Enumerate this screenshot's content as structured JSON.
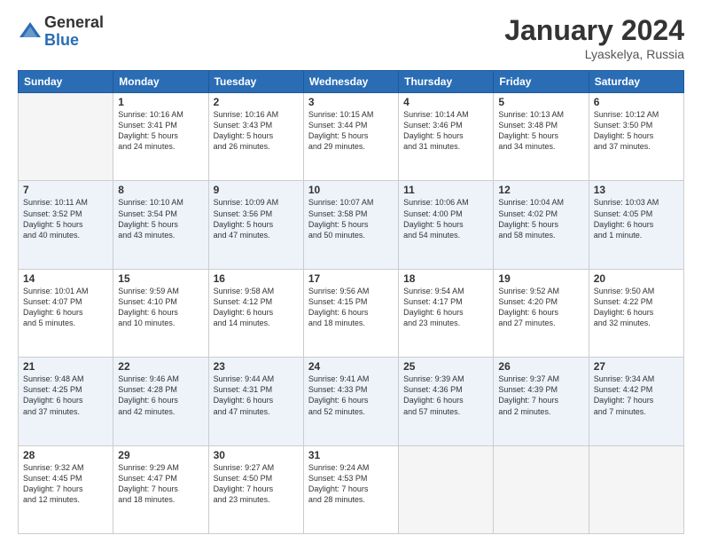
{
  "logo": {
    "general": "General",
    "blue": "Blue"
  },
  "header": {
    "month": "January 2024",
    "location": "Lyaskelya, Russia"
  },
  "weekdays": [
    "Sunday",
    "Monday",
    "Tuesday",
    "Wednesday",
    "Thursday",
    "Friday",
    "Saturday"
  ],
  "weeks": [
    [
      {
        "day": "",
        "info": ""
      },
      {
        "day": "1",
        "info": "Sunrise: 10:16 AM\nSunset: 3:41 PM\nDaylight: 5 hours\nand 24 minutes."
      },
      {
        "day": "2",
        "info": "Sunrise: 10:16 AM\nSunset: 3:43 PM\nDaylight: 5 hours\nand 26 minutes."
      },
      {
        "day": "3",
        "info": "Sunrise: 10:15 AM\nSunset: 3:44 PM\nDaylight: 5 hours\nand 29 minutes."
      },
      {
        "day": "4",
        "info": "Sunrise: 10:14 AM\nSunset: 3:46 PM\nDaylight: 5 hours\nand 31 minutes."
      },
      {
        "day": "5",
        "info": "Sunrise: 10:13 AM\nSunset: 3:48 PM\nDaylight: 5 hours\nand 34 minutes."
      },
      {
        "day": "6",
        "info": "Sunrise: 10:12 AM\nSunset: 3:50 PM\nDaylight: 5 hours\nand 37 minutes."
      }
    ],
    [
      {
        "day": "7",
        "info": "Sunrise: 10:11 AM\nSunset: 3:52 PM\nDaylight: 5 hours\nand 40 minutes."
      },
      {
        "day": "8",
        "info": "Sunrise: 10:10 AM\nSunset: 3:54 PM\nDaylight: 5 hours\nand 43 minutes."
      },
      {
        "day": "9",
        "info": "Sunrise: 10:09 AM\nSunset: 3:56 PM\nDaylight: 5 hours\nand 47 minutes."
      },
      {
        "day": "10",
        "info": "Sunrise: 10:07 AM\nSunset: 3:58 PM\nDaylight: 5 hours\nand 50 minutes."
      },
      {
        "day": "11",
        "info": "Sunrise: 10:06 AM\nSunset: 4:00 PM\nDaylight: 5 hours\nand 54 minutes."
      },
      {
        "day": "12",
        "info": "Sunrise: 10:04 AM\nSunset: 4:02 PM\nDaylight: 5 hours\nand 58 minutes."
      },
      {
        "day": "13",
        "info": "Sunrise: 10:03 AM\nSunset: 4:05 PM\nDaylight: 6 hours\nand 1 minute."
      }
    ],
    [
      {
        "day": "14",
        "info": "Sunrise: 10:01 AM\nSunset: 4:07 PM\nDaylight: 6 hours\nand 5 minutes."
      },
      {
        "day": "15",
        "info": "Sunrise: 9:59 AM\nSunset: 4:10 PM\nDaylight: 6 hours\nand 10 minutes."
      },
      {
        "day": "16",
        "info": "Sunrise: 9:58 AM\nSunset: 4:12 PM\nDaylight: 6 hours\nand 14 minutes."
      },
      {
        "day": "17",
        "info": "Sunrise: 9:56 AM\nSunset: 4:15 PM\nDaylight: 6 hours\nand 18 minutes."
      },
      {
        "day": "18",
        "info": "Sunrise: 9:54 AM\nSunset: 4:17 PM\nDaylight: 6 hours\nand 23 minutes."
      },
      {
        "day": "19",
        "info": "Sunrise: 9:52 AM\nSunset: 4:20 PM\nDaylight: 6 hours\nand 27 minutes."
      },
      {
        "day": "20",
        "info": "Sunrise: 9:50 AM\nSunset: 4:22 PM\nDaylight: 6 hours\nand 32 minutes."
      }
    ],
    [
      {
        "day": "21",
        "info": "Sunrise: 9:48 AM\nSunset: 4:25 PM\nDaylight: 6 hours\nand 37 minutes."
      },
      {
        "day": "22",
        "info": "Sunrise: 9:46 AM\nSunset: 4:28 PM\nDaylight: 6 hours\nand 42 minutes."
      },
      {
        "day": "23",
        "info": "Sunrise: 9:44 AM\nSunset: 4:31 PM\nDaylight: 6 hours\nand 47 minutes."
      },
      {
        "day": "24",
        "info": "Sunrise: 9:41 AM\nSunset: 4:33 PM\nDaylight: 6 hours\nand 52 minutes."
      },
      {
        "day": "25",
        "info": "Sunrise: 9:39 AM\nSunset: 4:36 PM\nDaylight: 6 hours\nand 57 minutes."
      },
      {
        "day": "26",
        "info": "Sunrise: 9:37 AM\nSunset: 4:39 PM\nDaylight: 7 hours\nand 2 minutes."
      },
      {
        "day": "27",
        "info": "Sunrise: 9:34 AM\nSunset: 4:42 PM\nDaylight: 7 hours\nand 7 minutes."
      }
    ],
    [
      {
        "day": "28",
        "info": "Sunrise: 9:32 AM\nSunset: 4:45 PM\nDaylight: 7 hours\nand 12 minutes."
      },
      {
        "day": "29",
        "info": "Sunrise: 9:29 AM\nSunset: 4:47 PM\nDaylight: 7 hours\nand 18 minutes."
      },
      {
        "day": "30",
        "info": "Sunrise: 9:27 AM\nSunset: 4:50 PM\nDaylight: 7 hours\nand 23 minutes."
      },
      {
        "day": "31",
        "info": "Sunrise: 9:24 AM\nSunset: 4:53 PM\nDaylight: 7 hours\nand 28 minutes."
      },
      {
        "day": "",
        "info": ""
      },
      {
        "day": "",
        "info": ""
      },
      {
        "day": "",
        "info": ""
      }
    ]
  ]
}
